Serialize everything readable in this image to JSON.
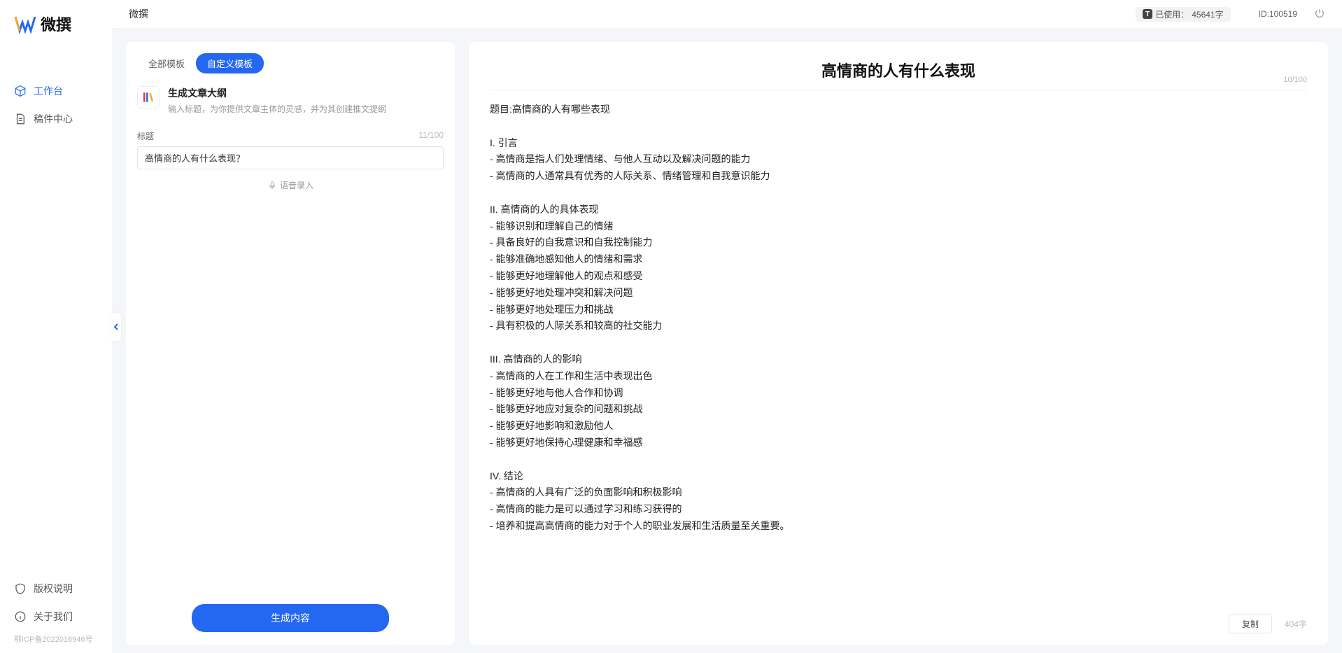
{
  "brand": "微撰",
  "sidebar": {
    "items": [
      {
        "label": "工作台",
        "active": true
      },
      {
        "label": "稿件中心",
        "active": false
      }
    ],
    "bottom": [
      {
        "label": "版权说明"
      },
      {
        "label": "关于我们"
      }
    ],
    "footer": "鄂ICP备2022016946号"
  },
  "topbar": {
    "title": "微撰",
    "usage_prefix": "已使用：",
    "usage_value": "45641字",
    "user_id_label": "ID:100519"
  },
  "left": {
    "tabs": [
      {
        "label": "全部模板",
        "active": false
      },
      {
        "label": "自定义模板",
        "active": true
      }
    ],
    "template": {
      "title": "生成文章大纲",
      "desc": "输入标题，为你提供文章主体的灵感，并为其创建推文提纲"
    },
    "field_label": "标题",
    "field_count": "11/100",
    "input_value": "高情商的人有什么表现？",
    "voice_label": "语音录入",
    "submit_label": "生成内容"
  },
  "right": {
    "title": "高情商的人有什么表现",
    "title_count": "10/100",
    "body": "题目:高情商的人有哪些表现\n\nI. 引言\n- 高情商是指人们处理情绪、与他人互动以及解决问题的能力\n- 高情商的人通常具有优秀的人际关系、情绪管理和自我意识能力\n\nII. 高情商的人的具体表现\n- 能够识别和理解自己的情绪\n- 具备良好的自我意识和自我控制能力\n- 能够准确地感知他人的情绪和需求\n- 能够更好地理解他人的观点和感受\n- 能够更好地处理冲突和解决问题\n- 能够更好地处理压力和挑战\n- 具有积极的人际关系和较高的社交能力\n\nIII. 高情商的人的影响\n- 高情商的人在工作和生活中表现出色\n- 能够更好地与他人合作和协调\n- 能够更好地应对复杂的问题和挑战\n- 能够更好地影响和激励他人\n- 能够更好地保持心理健康和幸福感\n\nIV. 结论\n- 高情商的人具有广泛的负面影响和积极影响\n- 高情商的能力是可以通过学习和练习获得的\n- 培养和提高高情商的能力对于个人的职业发展和生活质量至关重要。",
    "copy_label": "复制",
    "char_stat": "404字"
  }
}
